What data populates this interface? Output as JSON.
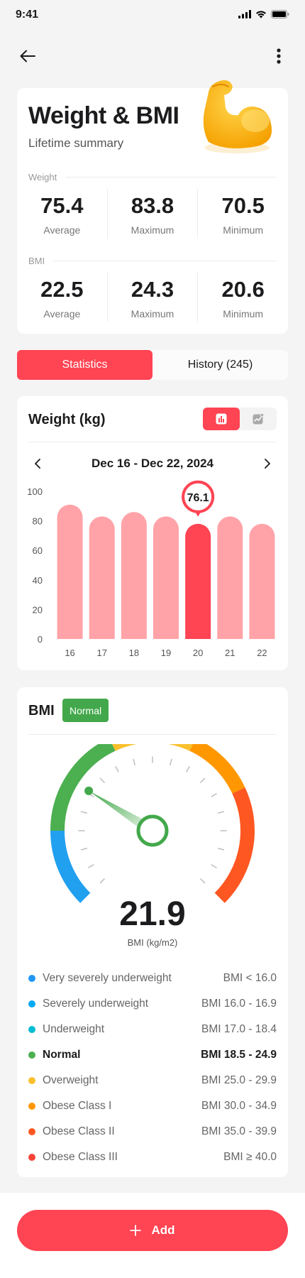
{
  "status": {
    "time": "9:41"
  },
  "summary": {
    "title": "Weight & BMI",
    "subtitle": "Lifetime summary",
    "weight": {
      "label": "Weight",
      "stats": [
        {
          "value": "75.4",
          "label": "Average"
        },
        {
          "value": "83.8",
          "label": "Maximum"
        },
        {
          "value": "70.5",
          "label": "Minimum"
        }
      ]
    },
    "bmi": {
      "label": "BMI",
      "stats": [
        {
          "value": "22.5",
          "label": "Average"
        },
        {
          "value": "24.3",
          "label": "Maximum"
        },
        {
          "value": "20.6",
          "label": "Minimum"
        }
      ]
    }
  },
  "tabs": [
    {
      "label": "Statistics",
      "active": true
    },
    {
      "label": "History (245)",
      "active": false
    }
  ],
  "weight_chart": {
    "title": "Weight (kg)",
    "range_label": "Dec 16 - Dec 22, 2024",
    "highlight_label": "76.1"
  },
  "chart_data": {
    "type": "bar",
    "categories": [
      "16",
      "17",
      "18",
      "19",
      "20",
      "21",
      "22"
    ],
    "values": [
      91,
      83,
      86,
      83,
      78,
      83,
      78
    ],
    "highlight_index": 4,
    "ylim": [
      0,
      100
    ],
    "yticks": [
      0,
      20,
      40,
      60,
      80,
      100
    ],
    "colors": {
      "bar": "#ffa3a8",
      "highlight": "#ff4453"
    }
  },
  "bmi": {
    "title": "BMI",
    "badge": "Normal",
    "value": "21.9",
    "unit": "BMI (kg/m2)",
    "categories": [
      {
        "name": "Very severely underweight",
        "range": "BMI < 16.0",
        "color": "#2196f3",
        "bold": false
      },
      {
        "name": "Severely underweight",
        "range": "BMI 16.0 - 16.9",
        "color": "#03a9f4",
        "bold": false
      },
      {
        "name": "Underweight",
        "range": "BMI 17.0 - 18.4",
        "color": "#00bcd4",
        "bold": false
      },
      {
        "name": "Normal",
        "range": "BMI 18.5 - 24.9",
        "color": "#4caf50",
        "bold": true
      },
      {
        "name": "Overweight",
        "range": "BMI 25.0 - 29.9",
        "color": "#fbc02d",
        "bold": false
      },
      {
        "name": "Obese Class I",
        "range": "BMI 30.0 - 34.9",
        "color": "#ff9800",
        "bold": false
      },
      {
        "name": "Obese Class II",
        "range": "BMI 35.0 - 39.9",
        "color": "#ff5722",
        "bold": false
      },
      {
        "name": "Obese Class III",
        "range": "BMI ≥ 40.0",
        "color": "#f44336",
        "bold": false
      }
    ]
  },
  "add_button": {
    "label": "Add"
  }
}
